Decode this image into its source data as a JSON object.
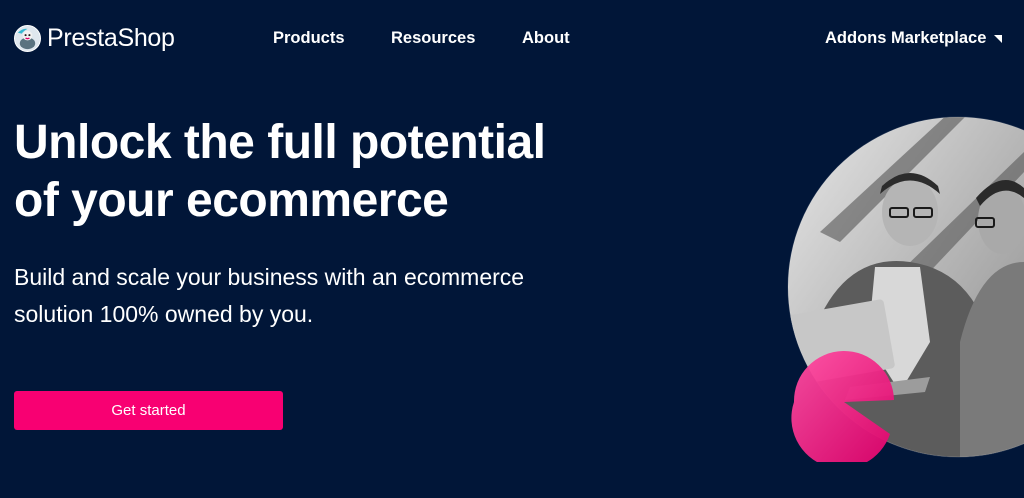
{
  "brand": {
    "name": "PrestaShop"
  },
  "nav": {
    "items": [
      {
        "label": "Products"
      },
      {
        "label": "Resources"
      },
      {
        "label": "About"
      }
    ],
    "addons_label": "Addons Marketplace"
  },
  "hero": {
    "title_line1": "Unlock the full potential",
    "title_line2": "of your ecommerce",
    "subtitle_line1": "Build and scale your business with an ecommerce",
    "subtitle_line2": "solution 100% owned by you.",
    "cta_label": "Get started"
  },
  "colors": {
    "background": "#011638",
    "accent": "#f80072",
    "text": "#ffffff"
  }
}
